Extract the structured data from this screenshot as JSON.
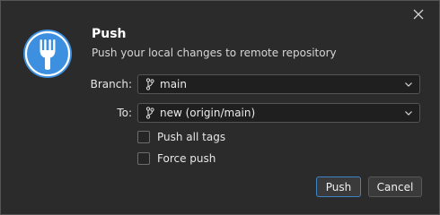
{
  "dialog": {
    "title": "Push",
    "subtitle": "Push your local changes to remote repository",
    "icons": {
      "close": "close-icon",
      "logo": "fork-logo-icon",
      "branch": "git-branch-icon",
      "dropdown": "chevron-down-icon"
    },
    "colors": {
      "background": "#2b2b2b",
      "logo_blue": "#3d8fe0",
      "primary_border": "#3d84c6"
    }
  },
  "form": {
    "branch_label": "Branch:",
    "branch_value": "main",
    "to_label": "To:",
    "to_value": "new (origin/main)",
    "push_all_tags_label": "Push all tags",
    "push_all_tags_checked": false,
    "force_push_label": "Force push",
    "force_push_checked": false
  },
  "buttons": {
    "push": "Push",
    "cancel": "Cancel"
  }
}
